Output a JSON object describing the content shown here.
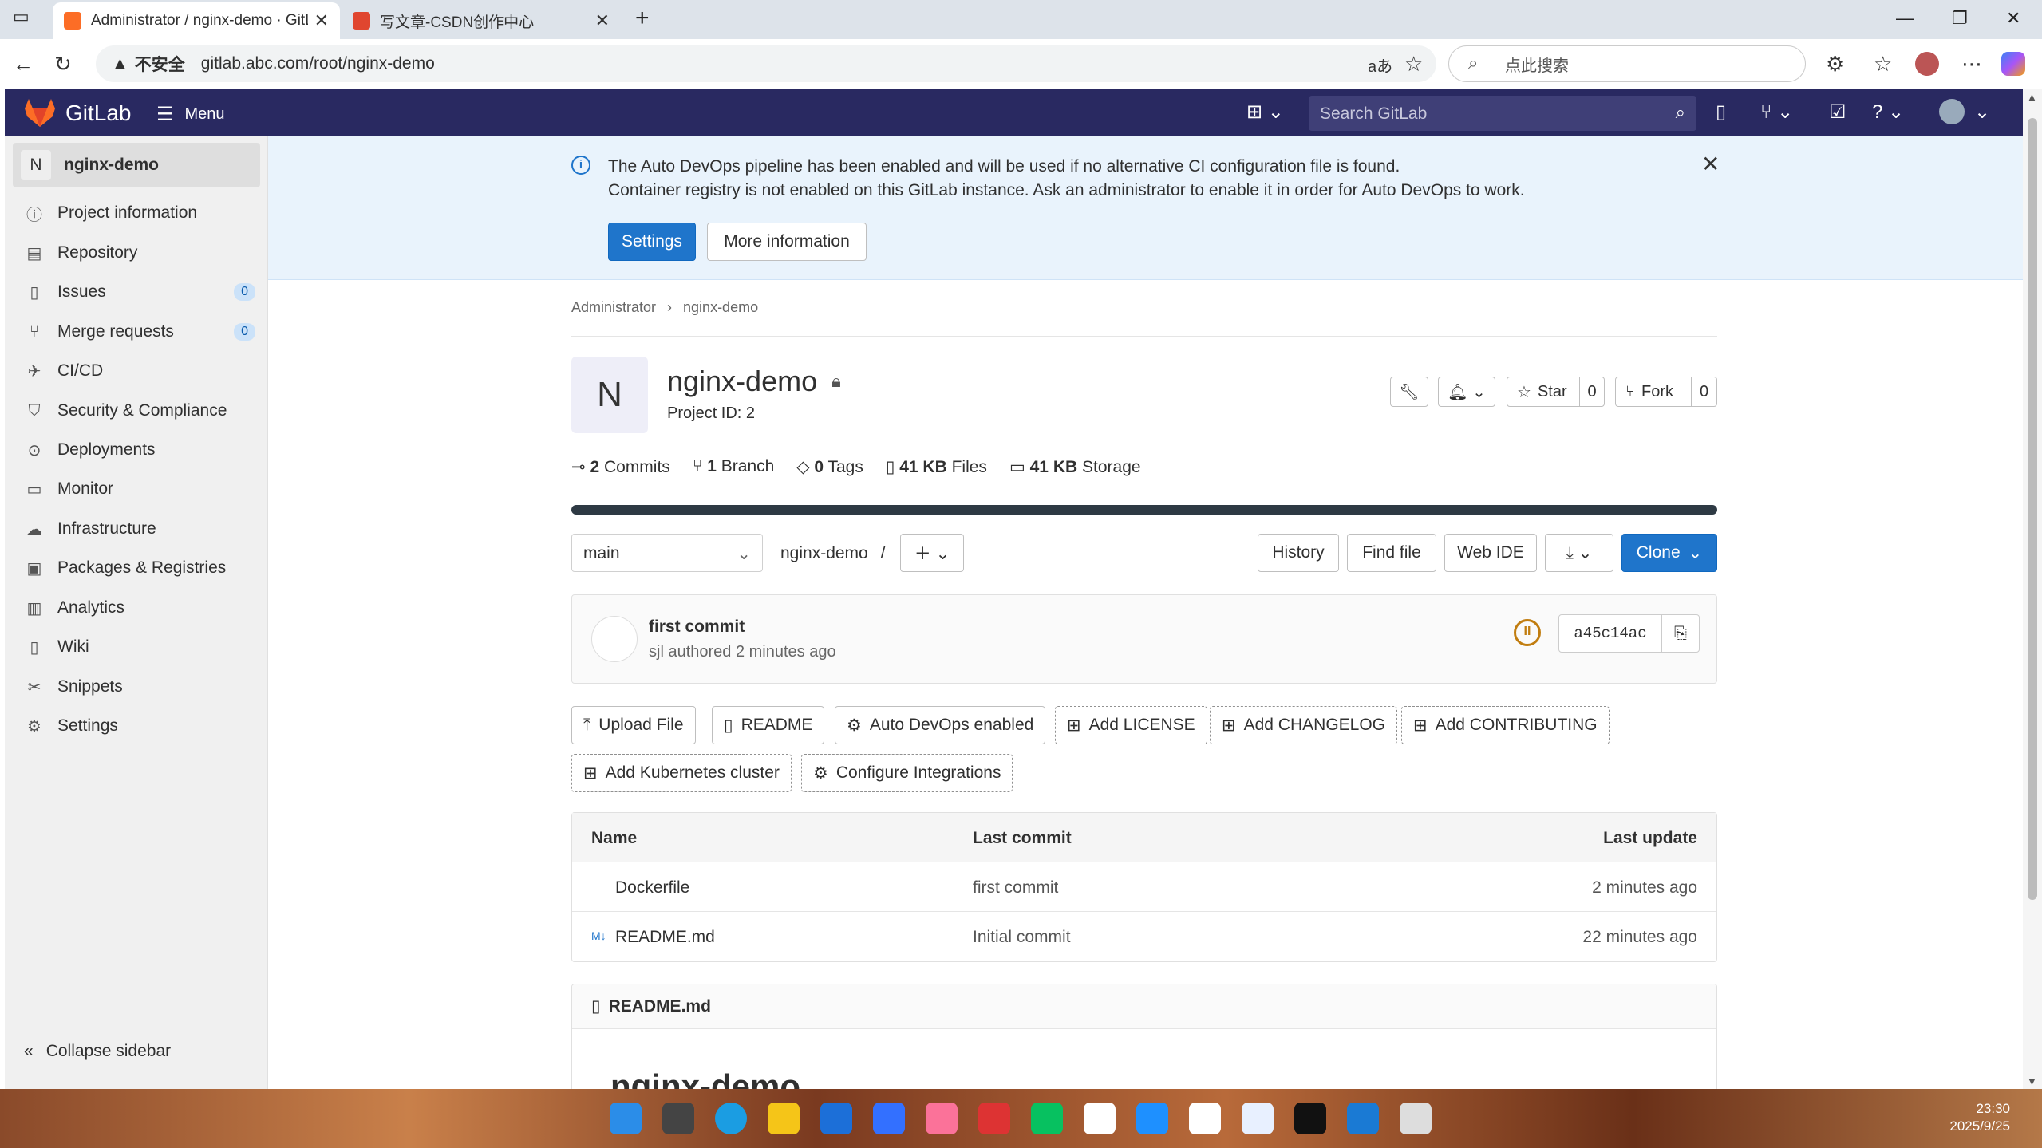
{
  "browser": {
    "tabs": [
      {
        "title": "Administrator / nginx-demo · GitL",
        "active": true
      },
      {
        "title": "写文章-CSDN创作中心",
        "active": false
      }
    ],
    "security_label": "不安全",
    "url": "gitlab.abc.com/root/nginx-demo",
    "search_placeholder": "点此搜索"
  },
  "gitlab": {
    "brand": "GitLab",
    "menu_label": "Menu",
    "search_placeholder": "Search GitLab"
  },
  "sidebar": {
    "project_initial": "N",
    "project_name": "nginx-demo",
    "items": [
      {
        "label": "Project information",
        "icon": "info-icon"
      },
      {
        "label": "Repository",
        "icon": "repository-icon"
      },
      {
        "label": "Issues",
        "icon": "issues-icon",
        "count": "0"
      },
      {
        "label": "Merge requests",
        "icon": "merge-request-icon",
        "count": "0"
      },
      {
        "label": "CI/CD",
        "icon": "rocket-icon"
      },
      {
        "label": "Security & Compliance",
        "icon": "shield-icon"
      },
      {
        "label": "Deployments",
        "icon": "deployments-icon"
      },
      {
        "label": "Monitor",
        "icon": "monitor-icon"
      },
      {
        "label": "Infrastructure",
        "icon": "cloud-icon"
      },
      {
        "label": "Packages & Registries",
        "icon": "package-icon"
      },
      {
        "label": "Analytics",
        "icon": "chart-icon"
      },
      {
        "label": "Wiki",
        "icon": "book-icon"
      },
      {
        "label": "Snippets",
        "icon": "scissors-icon"
      },
      {
        "label": "Settings",
        "icon": "gear-icon"
      }
    ],
    "collapse_label": "Collapse sidebar"
  },
  "banner": {
    "line1": "The Auto DevOps pipeline has been enabled and will be used if no alternative CI configuration file is found.",
    "line2": "Container registry is not enabled on this GitLab instance. Ask an administrator to enable it in order for Auto DevOps to work.",
    "settings_label": "Settings",
    "more_info_label": "More information"
  },
  "breadcrumb": {
    "items": [
      "Administrator",
      "nginx-demo"
    ]
  },
  "project": {
    "initial": "N",
    "name": "nginx-demo",
    "id_label": "Project ID: 2",
    "star_label": "Star",
    "star_count": "0",
    "fork_label": "Fork",
    "fork_count": "0",
    "stats": {
      "commits_num": "2",
      "commits_label": "Commits",
      "branch_num": "1",
      "branch_label": "Branch",
      "tags_num": "0",
      "tags_label": "Tags",
      "files_num": "41 KB",
      "files_label": "Files",
      "storage_num": "41 KB",
      "storage_label": "Storage"
    }
  },
  "repo": {
    "branch": "main",
    "path": "nginx-demo",
    "path_sep": "/",
    "history_label": "History",
    "find_file_label": "Find file",
    "web_ide_label": "Web IDE",
    "clone_label": "Clone"
  },
  "commit": {
    "message": "first commit",
    "meta": "sjl authored 2 minutes ago",
    "sha": "a45c14ac"
  },
  "quick_actions": [
    "Upload File",
    "README",
    "Auto DevOps enabled",
    "Add LICENSE",
    "Add CHANGELOG",
    "Add CONTRIBUTING",
    "Add Kubernetes cluster",
    "Configure Integrations"
  ],
  "files": {
    "headers": {
      "name": "Name",
      "last_commit": "Last commit",
      "last_update": "Last update"
    },
    "rows": [
      {
        "name": "Dockerfile",
        "commit": "first commit",
        "updated": "2 minutes ago"
      },
      {
        "name": "README.md",
        "commit": "Initial commit",
        "updated": "22 minutes ago"
      }
    ]
  },
  "readme": {
    "filename": "README.md",
    "heading": "nginx-demo"
  },
  "taskbar": {
    "time": "23:30",
    "date": "2025/9/25"
  },
  "colors": {
    "header_bg": "#292961",
    "primary": "#1f75cb",
    "banner_bg": "#e9f3fc"
  }
}
